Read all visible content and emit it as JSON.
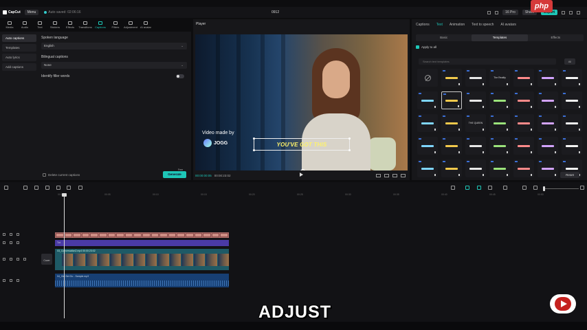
{
  "titlebar": {
    "app_name": "CapCut",
    "menu_label": "Menu",
    "autosave": "Auto saved: 02:06:16",
    "project_title": "0912",
    "right_pills": [
      "16 Pro",
      "Share",
      "Export"
    ],
    "overlay_badge": "php"
  },
  "toolbar": {
    "tools": [
      {
        "label": "Media",
        "icon": "media-icon"
      },
      {
        "label": "Audio",
        "icon": "audio-icon"
      },
      {
        "label": "Text",
        "icon": "text-icon"
      },
      {
        "label": "Stickers",
        "icon": "stickers-icon"
      },
      {
        "label": "Effects",
        "icon": "effects-icon"
      },
      {
        "label": "Transitions",
        "icon": "transitions-icon"
      },
      {
        "label": "Captions",
        "icon": "captions-icon",
        "active": true
      },
      {
        "label": "Filters",
        "icon": "filters-icon"
      },
      {
        "label": "Adjustment",
        "icon": "adjustment-icon"
      },
      {
        "label": "AI avatar",
        "icon": "ai-avatar-icon"
      }
    ]
  },
  "leftpanel": {
    "side_items": [
      "Auto captions",
      "Templates",
      "Auto lyrics",
      "Add captions"
    ],
    "spoken_language_label": "Spoken language",
    "spoken_language_value": "English",
    "bilingual_label": "Bilingual captions",
    "bilingual_value": "None",
    "filler_label": "Identify filler words",
    "delete_label": "Delete current captions",
    "generate_label": "Generate",
    "free_tag": "Free"
  },
  "player": {
    "title": "Player",
    "watermark_line": "Video made by",
    "watermark_brand": "JOGG",
    "caption": "YOU'VE GOT THIS",
    "time_current": "00:00:00:05",
    "time_total": "00:00:23:02"
  },
  "rightpanel": {
    "tabs": [
      "Captions",
      "Text",
      "Animation",
      "Text to speech",
      "AI avatars"
    ],
    "active_tab": "Text",
    "subtabs": [
      "Basic",
      "Templates",
      "Effects"
    ],
    "active_subtab": "Templates",
    "apply_all": "Apply to all",
    "search_placeholder": "Search text templates",
    "filter_label": "All",
    "reset_label": "Reset",
    "template_samples": [
      "",
      "",
      "",
      "The Reality",
      "",
      "",
      "",
      "",
      "",
      "",
      "",
      "",
      "",
      "",
      "",
      "",
      "THE QUEEN",
      "",
      "",
      "",
      "",
      "",
      "",
      "",
      "",
      "",
      "",
      "",
      "",
      "",
      "",
      "",
      "",
      "",
      ""
    ]
  },
  "timeline": {
    "ruler_ticks": [
      "00:00",
      "00:05",
      "00:10",
      "00:15",
      "00:20",
      "00:25",
      "00:30",
      "00:35",
      "00:40",
      "00:45",
      "00:50"
    ],
    "text_clip": "Txt",
    "video_clip": "03_Conversation2.mp4  00:00:23:02",
    "audio_clip": "04_Get Set Go - Sample.mp3",
    "cover_label": "Cover"
  },
  "overlay": {
    "subtitle": "ADJUST"
  },
  "colors": {
    "accent": "#1ec7b8",
    "caption_yellow": "#fff36a",
    "caption_track": "#b4726e",
    "text_track": "#4a3aa6",
    "video_track": "#1e5a66",
    "audio_track": "#173f73"
  }
}
